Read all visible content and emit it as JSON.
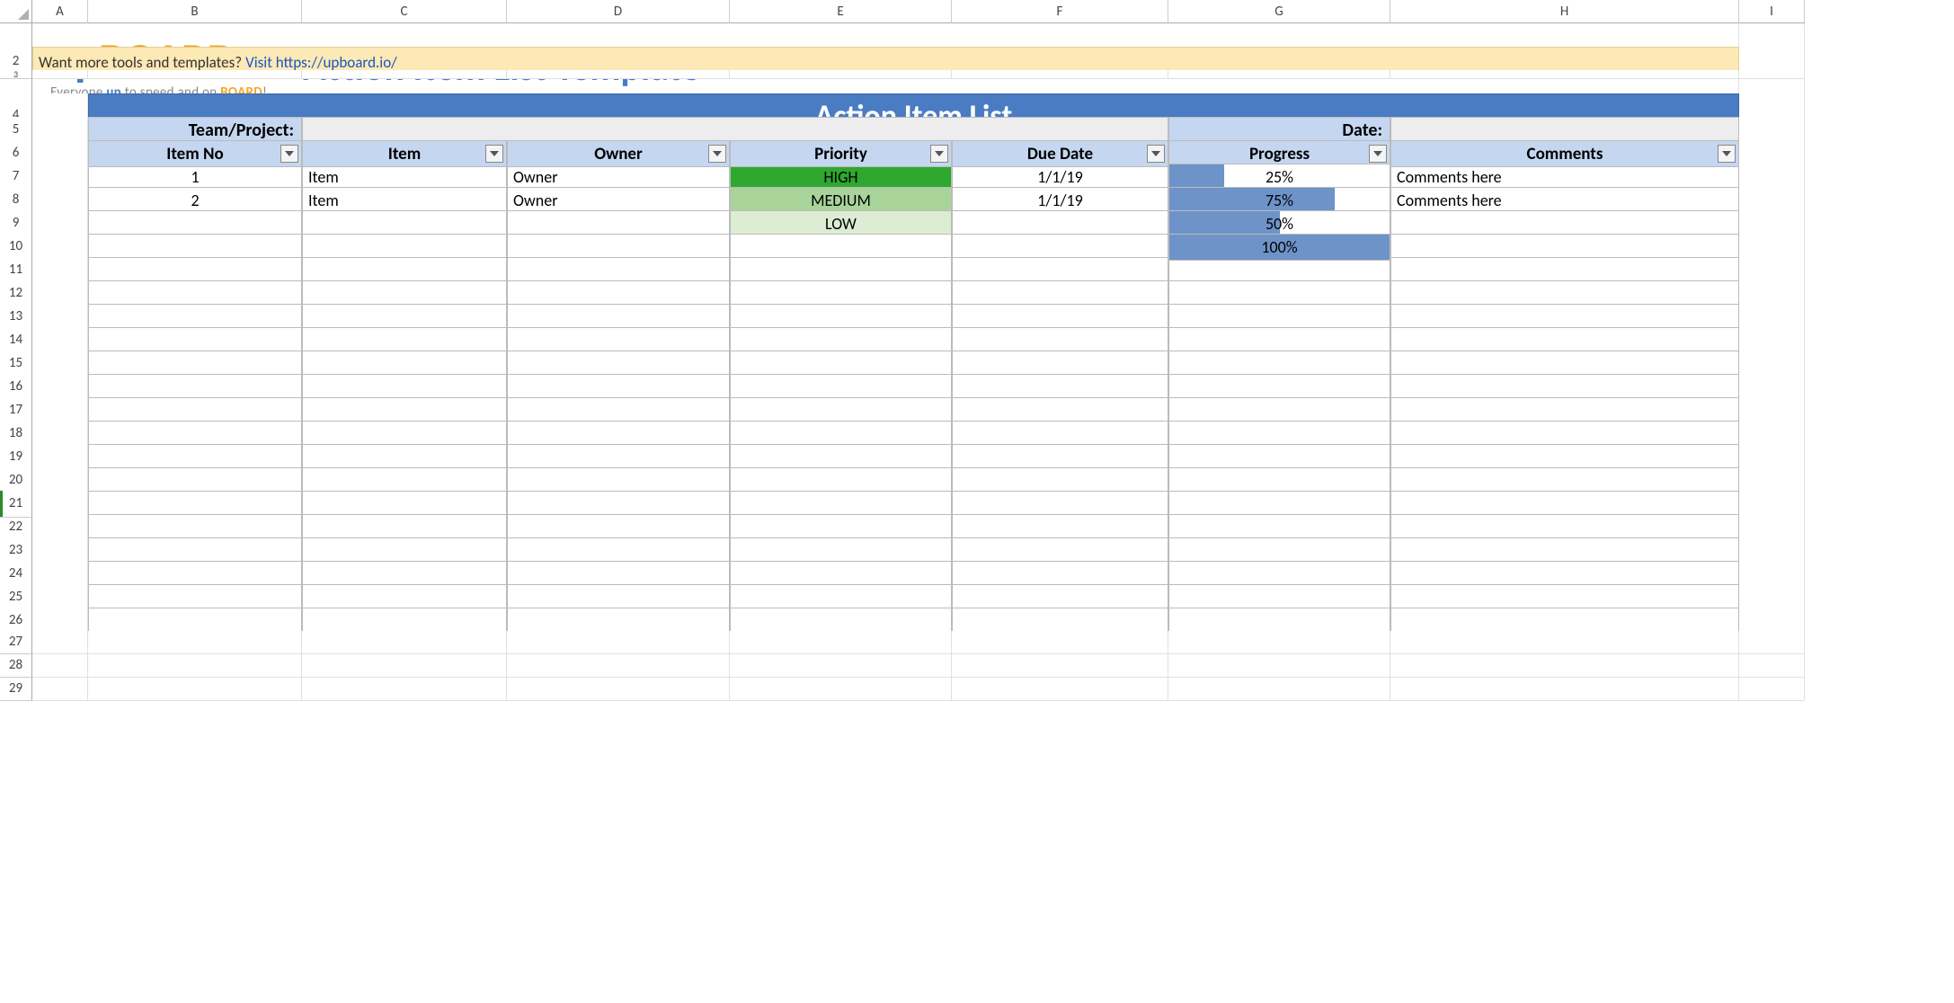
{
  "columns": [
    "A",
    "B",
    "C",
    "D",
    "E",
    "F",
    "G",
    "H",
    "I"
  ],
  "logo": {
    "part1": "up",
    "part2": "BOARD",
    "tagline_pre": "Everyone ",
    "tagline_b1": "up",
    "tagline_mid": " to speed and on ",
    "tagline_b2": "BOARD",
    "tagline_post": "!"
  },
  "page_title": "Action Item List Template",
  "banner": {
    "text": "Want more tools and templates?",
    "link_text": "Visit https://upboard.io/"
  },
  "title_bar": "Action Item List",
  "labels": {
    "team_project": "Team/Project:",
    "date": "Date:"
  },
  "headers": [
    "Item No",
    "Item",
    "Owner",
    "Priority",
    "Due Date",
    "Progress",
    "Comments"
  ],
  "rows": [
    {
      "no": "1",
      "item": "Item",
      "owner": "Owner",
      "priority": "HIGH",
      "pri_class": "pri-high",
      "due": "1/1/19",
      "progress": 25,
      "progress_txt": "25%",
      "comments": "Comments here"
    },
    {
      "no": "2",
      "item": "Item",
      "owner": "Owner",
      "priority": "MEDIUM",
      "pri_class": "pri-med",
      "due": "1/1/19",
      "progress": 75,
      "progress_txt": "75%",
      "comments": "Comments here"
    },
    {
      "no": "",
      "item": "",
      "owner": "",
      "priority": "LOW",
      "pri_class": "pri-low",
      "due": "",
      "progress": 50,
      "progress_txt": "50%",
      "comments": ""
    },
    {
      "no": "",
      "item": "",
      "owner": "",
      "priority": "",
      "pri_class": "",
      "due": "",
      "progress": 100,
      "progress_txt": "100%",
      "comments": ""
    }
  ],
  "empty_row_count": 16,
  "row_numbers_tail": [
    27,
    28,
    29
  ],
  "selected_row": 21
}
